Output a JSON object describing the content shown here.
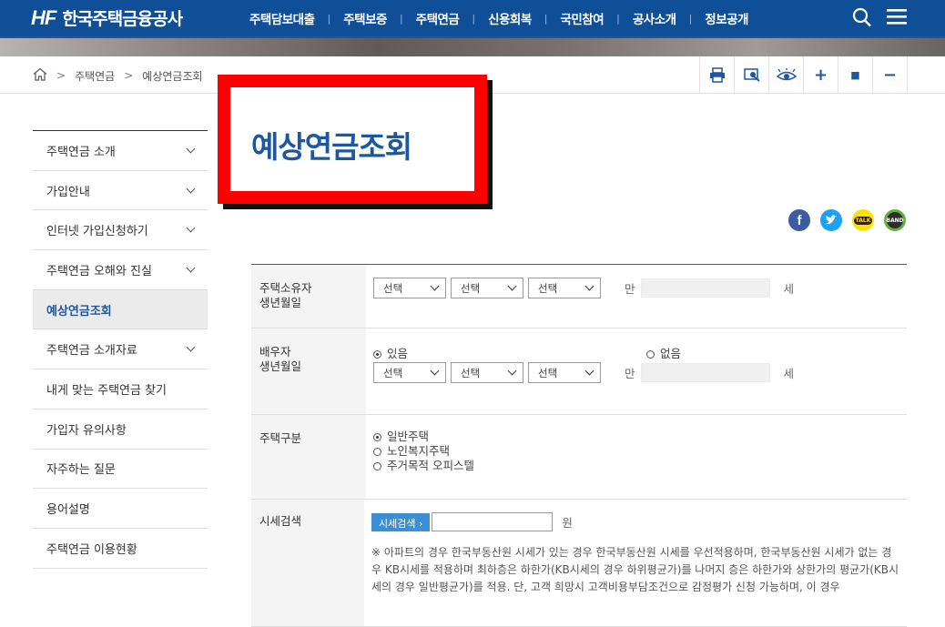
{
  "header": {
    "logo_mark": "HF",
    "logo_name": "한국주택금융공사",
    "nav": [
      "주택담보대출",
      "주택보증",
      "주택연금",
      "신용회복",
      "국민참여",
      "공사소개",
      "정보공개"
    ]
  },
  "breadcrumb": {
    "items": [
      "주택연금",
      "예상연금조회"
    ]
  },
  "tools": [
    "print",
    "view",
    "eye",
    "+",
    "■",
    "−"
  ],
  "sidebar": {
    "items": [
      {
        "label": "주택연금 소개",
        "expandable": true,
        "active": false
      },
      {
        "label": "가입안내",
        "expandable": true,
        "active": false
      },
      {
        "label": "인터넷 가입신청하기",
        "expandable": true,
        "active": false
      },
      {
        "label": "주택연금 오해와 진실",
        "expandable": true,
        "active": false
      },
      {
        "label": "예상연금조회",
        "expandable": false,
        "active": true
      },
      {
        "label": "주택연금 소개자료",
        "expandable": true,
        "active": false
      },
      {
        "label": "내게 맞는 주택연금 찾기",
        "expandable": false,
        "active": false
      },
      {
        "label": "가입자 유의사항",
        "expandable": false,
        "active": false
      },
      {
        "label": "자주하는 질문",
        "expandable": false,
        "active": false
      },
      {
        "label": "용어설명",
        "expandable": false,
        "active": false
      },
      {
        "label": "주택연금 이용현황",
        "expandable": false,
        "active": false
      }
    ]
  },
  "page_title": "예상연금조회",
  "social": {
    "facebook": "f",
    "twitter": "t",
    "kakaotalk": "TALK",
    "band": "BAND"
  },
  "form": {
    "owner": {
      "label_1": "주택소유자",
      "label_2": "생년월일",
      "select_1": "선택",
      "select_2": "선택",
      "select_3": "선택",
      "man": "만",
      "age_unit": "세"
    },
    "spouse": {
      "label_1": "배우자",
      "label_2": "생년월일",
      "yes": "있음",
      "no": "없음",
      "select_1": "선택",
      "select_2": "선택",
      "select_3": "선택",
      "man": "만",
      "age_unit": "세"
    },
    "house_type": {
      "label": "주택구분",
      "options": [
        "일반주택",
        "노인복지주택",
        "주거목적 오피스텔"
      ]
    },
    "price_search": {
      "label": "시세검색",
      "button": "시세검색 ›",
      "unit": "원",
      "note": "※ 아파트의 경우 한국부동산원 시세가 있는 경우 한국부동산원 시세를 우선적용하며, 한국부동산원 시세가 없는 경우 KB시세를 적용하며 최하층은 하한가(KB시세의 경우 하위평균가)를 나머지 층은 하한가와 상한가의 평균가(KB시세의 경우 일반평균가)를 적용. 단, 고객 희망시 고객비용부담조건으로 감정평가 신청 가능하며, 이 경우"
    }
  },
  "colors": {
    "brand": "#0e4f98",
    "accent": "#1c57a0",
    "highlight_border": "#ff0000",
    "search_button": "#3d8fd4"
  }
}
